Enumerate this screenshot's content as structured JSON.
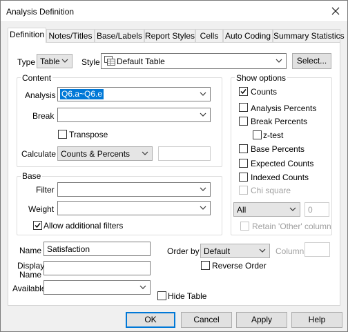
{
  "window": {
    "title": "Analysis Definition"
  },
  "tabs": [
    "Definition",
    "Notes/Titles",
    "Base/Labels",
    "Report Styles",
    "Cells",
    "Auto Coding",
    "Summary Statistics"
  ],
  "top": {
    "type_label": "Type",
    "type_value": "Table",
    "style_label": "Style",
    "style_value": "Default Table",
    "select_button": "Select..."
  },
  "content": {
    "legend": "Content",
    "analysis_label": "Analysis",
    "analysis_value": "Q6.a~Q6.e",
    "break_label": "Break",
    "break_value": "",
    "transpose_label": "Transpose",
    "calculate_label": "Calculate",
    "calculate_value": "Counts & Percents",
    "calculate_extra": ""
  },
  "base": {
    "legend": "Base",
    "filter_label": "Filter",
    "filter_value": "",
    "weight_label": "Weight",
    "weight_value": "",
    "allow_filters_label": "Allow additional filters",
    "allow_filters_checked": true
  },
  "show_options": {
    "legend": "Show options",
    "items": [
      {
        "label": "Counts",
        "checked": true,
        "enabled": true
      },
      {
        "label": "Analysis Percents",
        "checked": false,
        "enabled": true
      },
      {
        "label": "Break Percents",
        "checked": false,
        "enabled": true
      },
      {
        "label": "z-test",
        "checked": false,
        "enabled": true
      },
      {
        "label": "Base Percents",
        "checked": false,
        "enabled": true
      },
      {
        "label": "Expected Counts",
        "checked": false,
        "enabled": true
      },
      {
        "label": "Indexed Counts",
        "checked": false,
        "enabled": true
      },
      {
        "label": "Chi square",
        "checked": false,
        "enabled": false
      }
    ],
    "all_value": "All",
    "all_number": "0",
    "retain_other_label": "Retain 'Other' column"
  },
  "bottom": {
    "name_label": "Name",
    "name_value": "Satisfaction",
    "display_name_label_1": "Display",
    "display_name_label_2": "Name",
    "display_name_value": "",
    "available_label": "Available",
    "available_value": "",
    "order_by_label": "Order by",
    "order_by_value": "Default",
    "column_label": "Column",
    "column_value": "",
    "reverse_order_label": "Reverse Order",
    "hide_table_label": "Hide Table"
  },
  "buttons": {
    "ok": "OK",
    "cancel": "Cancel",
    "apply": "Apply",
    "help": "Help"
  }
}
